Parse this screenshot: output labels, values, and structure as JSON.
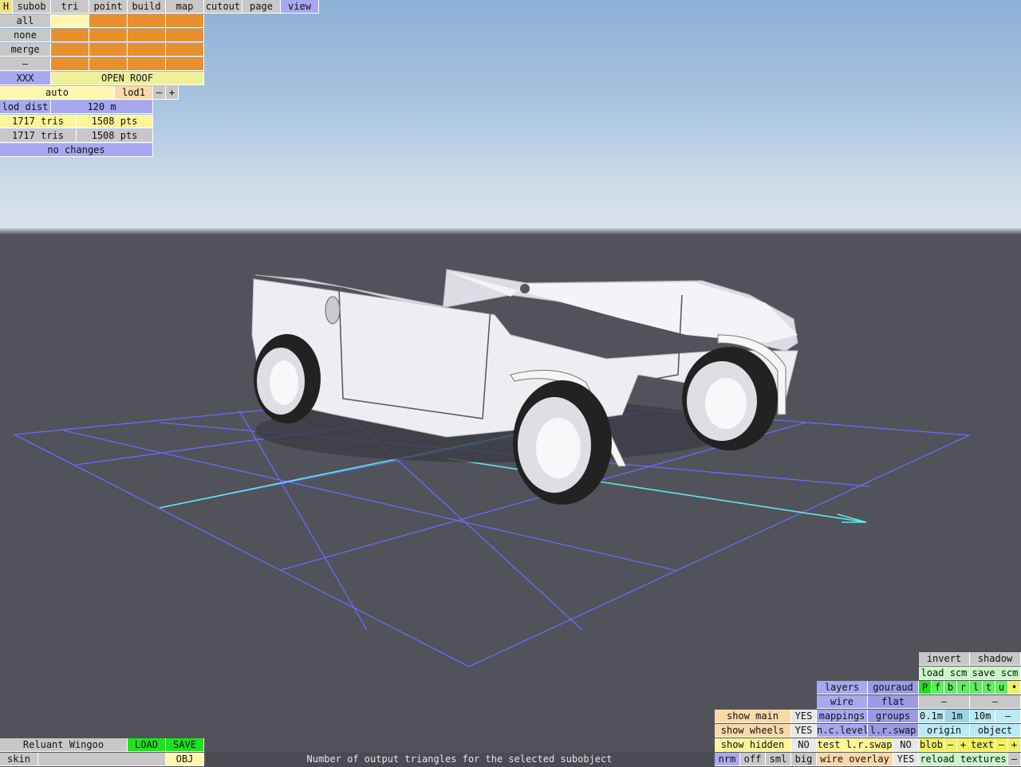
{
  "toolbar": {
    "h": "H",
    "tabs": [
      "subob",
      "tri",
      "point",
      "build",
      "map",
      "cutout",
      "page",
      "view"
    ],
    "active_tab": "view"
  },
  "subob_panel": {
    "all": "all",
    "none": "none",
    "merge": "merge",
    "dash": "–",
    "xxx": "XXX",
    "name": "OPEN ROOF",
    "auto": "auto",
    "lod": "lod1",
    "lod_minus": "–",
    "lod_plus": "+",
    "lod_dist_label": "lod dist",
    "lod_dist_value": "120 m",
    "tris1": "1717 tris",
    "pts1": "1508 pts",
    "tris2": "1717 tris",
    "pts2": "1508 pts",
    "changes": "no changes"
  },
  "bottom_left": {
    "model_name": "Reluant Wingoo",
    "load": "LOAD",
    "save": "SAVE",
    "skin": "skin",
    "obj": "OBJ"
  },
  "status_text": "Number of output triangles for the selected subobject",
  "view_panel": {
    "invert": "invert",
    "shadow": "shadow",
    "load_scm": "load scm",
    "save_scm": "save scm",
    "layers": "layers",
    "gouraud": "gouraud",
    "layer_buttons": [
      "P",
      "f",
      "b",
      "r",
      "l",
      "t",
      "u",
      "•"
    ],
    "wire": "wire",
    "flat": "flat",
    "dash1": "–",
    "dash2": "–",
    "show_main": "show main",
    "show_main_val": "YES",
    "mappings": "mappings",
    "groups": "groups",
    "grid_01": "0.1m",
    "grid_1": "1m",
    "grid_10": "10m",
    "grid_dash": "–",
    "show_wheels": "show wheels",
    "show_wheels_val": "YES",
    "nc_level": "n.c.level",
    "lr_swap": "l.r.swap",
    "origin": "origin",
    "object": "object",
    "show_hidden": "show hidden",
    "show_hidden_val": "NO",
    "test_lr_swap": "test l.r.swap",
    "test_lr_swap_val": "NO",
    "blob": "blob",
    "blob_minus": "–",
    "blob_plus": "+",
    "text": "text",
    "text_minus": "–",
    "text_plus": "+",
    "nrm": "nrm",
    "off": "off",
    "sml": "sml",
    "big": "big",
    "wire_overlay": "wire overlay",
    "wire_overlay_val": "YES",
    "reload_textures": "reload textures",
    "reload_dash": "–"
  },
  "colors": {
    "sky_top": "#8db0d6",
    "ground": "#52525a",
    "grid_line": "#6a6aff",
    "axis_line": "#60e8e8",
    "car_body": "#e9e9ee"
  }
}
